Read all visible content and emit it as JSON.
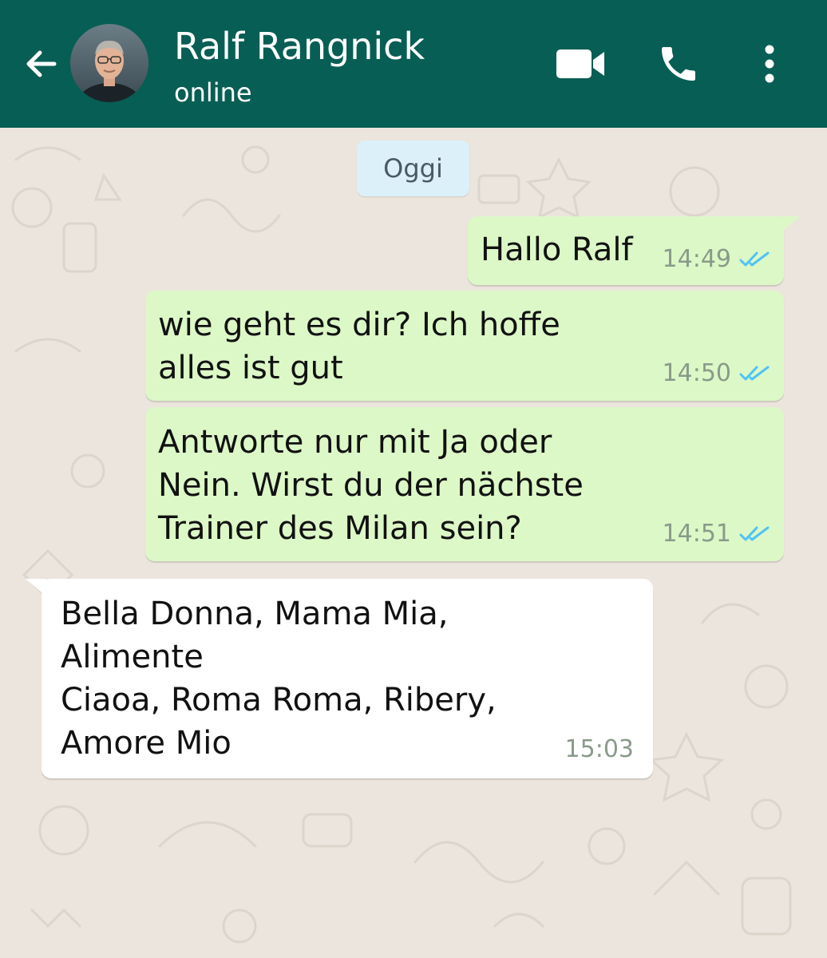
{
  "header": {
    "contact_name": "Ralf Rangnick",
    "status": "online",
    "icons": [
      "back-arrow-icon",
      "avatar",
      "video-call-icon",
      "phone-icon",
      "more-vertical-icon"
    ],
    "bg_color": "#075e54"
  },
  "chat": {
    "date_label": "Oggi",
    "messages": [
      {
        "direction": "out",
        "text": "Hallo Ralf",
        "time": "14:49",
        "read": true
      },
      {
        "direction": "out",
        "text": "wie geht es dir? Ich hoffe\nalles ist gut",
        "time": "14:50",
        "read": true
      },
      {
        "direction": "out",
        "text": "Antworte nur mit Ja oder\nNein. Wirst du der nächste\nTrainer des Milan sein?",
        "time": "14:51",
        "read": true
      },
      {
        "direction": "in",
        "text": "Bella Donna, Mama Mia,\nAlimente\nCiaoa, Roma Roma, Ribery,\nAmore Mio",
        "time": "15:03"
      }
    ]
  },
  "colors": {
    "outgoing_bubble": "#dcf8c6",
    "incoming_bubble": "#ffffff",
    "chat_background": "#ece5dd",
    "read_tick": "#4fc3f7"
  }
}
